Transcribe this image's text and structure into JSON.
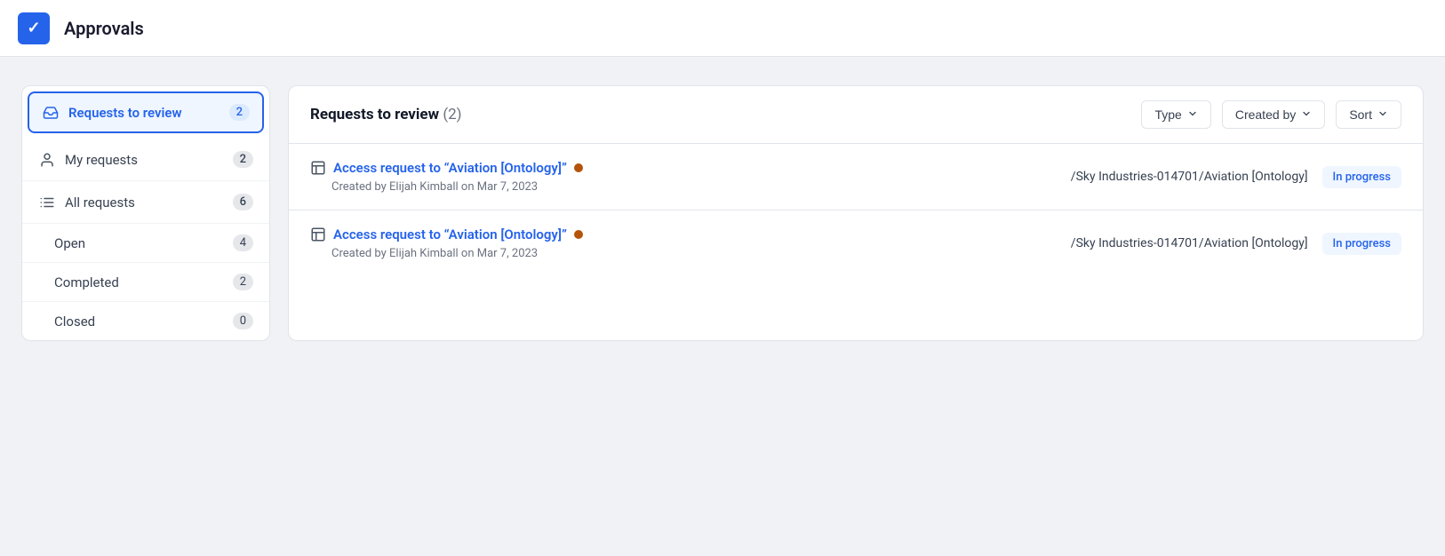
{
  "header": {
    "icon_label": "✓",
    "title": "Approvals"
  },
  "sidebar": {
    "items": [
      {
        "id": "requests-to-review",
        "label": "Requests to review",
        "count": "2",
        "active": true,
        "icon": "inbox"
      },
      {
        "id": "my-requests",
        "label": "My requests",
        "count": "2",
        "active": false,
        "icon": "person"
      },
      {
        "id": "all-requests",
        "label": "All requests",
        "count": "6",
        "active": false,
        "icon": "list"
      }
    ],
    "sub_items": [
      {
        "id": "open",
        "label": "Open",
        "count": "4"
      },
      {
        "id": "completed",
        "label": "Completed",
        "count": "2"
      },
      {
        "id": "closed",
        "label": "Closed",
        "count": "0"
      }
    ]
  },
  "panel": {
    "title": "Requests to review",
    "count": "(2)",
    "filters": {
      "type_label": "Type",
      "created_by_label": "Created by",
      "sort_label": "Sort"
    },
    "requests": [
      {
        "title": "Access request to “Aviation [Ontology]”",
        "meta": "Created by Elijah Kimball on Mar 7, 2023",
        "path": "/Sky Industries-014701/Aviation [Ontology]",
        "status": "In progress"
      },
      {
        "title": "Access request to “Aviation [Ontology]”",
        "meta": "Created by Elijah Kimball on Mar 7, 2023",
        "path": "/Sky Industries-014701/Aviation [Ontology]",
        "status": "In progress"
      }
    ]
  }
}
